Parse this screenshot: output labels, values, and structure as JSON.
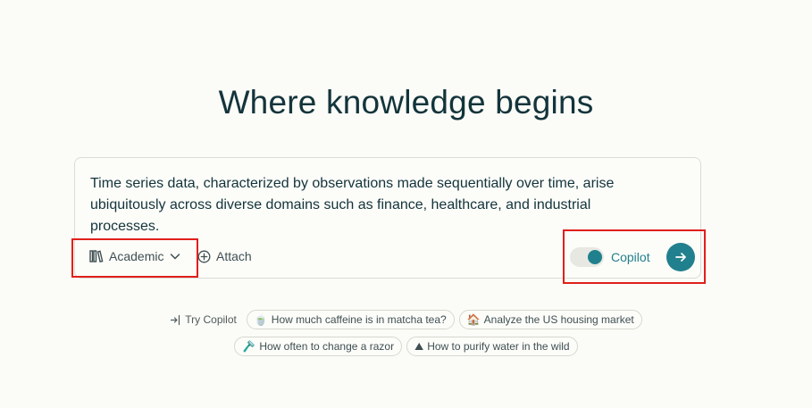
{
  "headline": "Where knowledge begins",
  "search": {
    "query_text": "Time series data, characterized by observations made sequentially over time, arise ubiquitously across diverse domains such as finance, healthcare, and industrial processes.",
    "focus_label": "Academic",
    "attach_label": "Attach",
    "copilot_label": "Copilot",
    "copilot_enabled": true
  },
  "suggestions": {
    "try_label": "Try Copilot",
    "items": [
      {
        "icon": "matcha-cup-icon",
        "emoji": "🍵",
        "label": "How much caffeine is in matcha tea?"
      },
      {
        "icon": "house-icon",
        "emoji": "🏠",
        "label": "Analyze the US housing market"
      },
      {
        "icon": "razor-icon",
        "emoji": "🪒",
        "label": "How often to change a razor"
      },
      {
        "icon": "mountain-icon",
        "emoji": "⛰",
        "label": "How to purify water in the wild"
      }
    ]
  },
  "colors": {
    "accent": "#21808d",
    "text": "#13343b",
    "background": "#fbfbf7",
    "highlight_box": "#e0201b"
  }
}
